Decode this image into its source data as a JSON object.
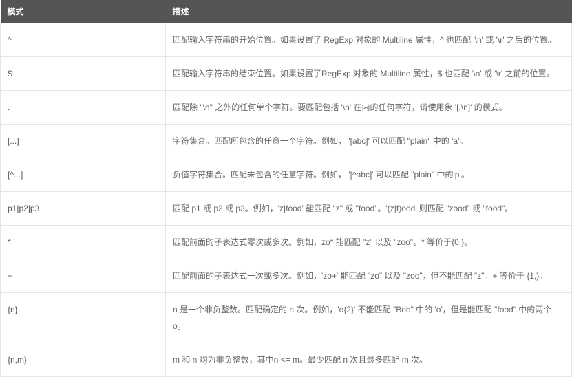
{
  "table": {
    "headers": {
      "pattern": "模式",
      "desc": "描述"
    },
    "rows": [
      {
        "pattern": "^",
        "desc": "匹配输入字符串的开始位置。如果设置了 RegExp 对象的 Multiline 属性，^ 也匹配 '\\n' 或 '\\r' 之后的位置。"
      },
      {
        "pattern": "$",
        "desc": "匹配输入字符串的结束位置。如果设置了RegExp 对象的 Multiline 属性，$ 也匹配 '\\n' 或 '\\r' 之前的位置。"
      },
      {
        "pattern": ".",
        "desc": "匹配除 \"\\n\" 之外的任何单个字符。要匹配包括 '\\n' 在内的任何字符，请使用象 '[.\\n]' 的模式。"
      },
      {
        "pattern": "[...]",
        "desc": "字符集合。匹配所包含的任意一个字符。例如， '[abc]' 可以匹配 \"plain\" 中的 'a'。"
      },
      {
        "pattern": "[^...]",
        "desc": "负值字符集合。匹配未包含的任意字符。例如， '[^abc]' 可以匹配 \"plain\" 中的'p'。"
      },
      {
        "pattern": "p1|p2|p3",
        "desc": "匹配 p1 或 p2 或 p3。例如，'z|food' 能匹配 \"z\" 或 \"food\"。'(z|f)ood' 则匹配 \"zood\" 或 \"food\"。"
      },
      {
        "pattern": "*",
        "desc": "匹配前面的子表达式零次或多次。例如，zo* 能匹配 \"z\" 以及 \"zoo\"。* 等价于{0,}。"
      },
      {
        "pattern": "+",
        "desc": "匹配前面的子表达式一次或多次。例如，'zo+' 能匹配 \"zo\" 以及 \"zoo\"，但不能匹配 \"z\"。+ 等价于 {1,}。"
      },
      {
        "pattern": "{n}",
        "desc": "n 是一个非负整数。匹配确定的 n 次。例如，'o{2}' 不能匹配 \"Bob\" 中的 'o'，但是能匹配 \"food\" 中的两个 o。"
      },
      {
        "pattern": "{n,m}",
        "desc": "m 和 n 均为非负整数，其中n <= m。最少匹配 n 次且最多匹配 m 次。"
      }
    ]
  }
}
